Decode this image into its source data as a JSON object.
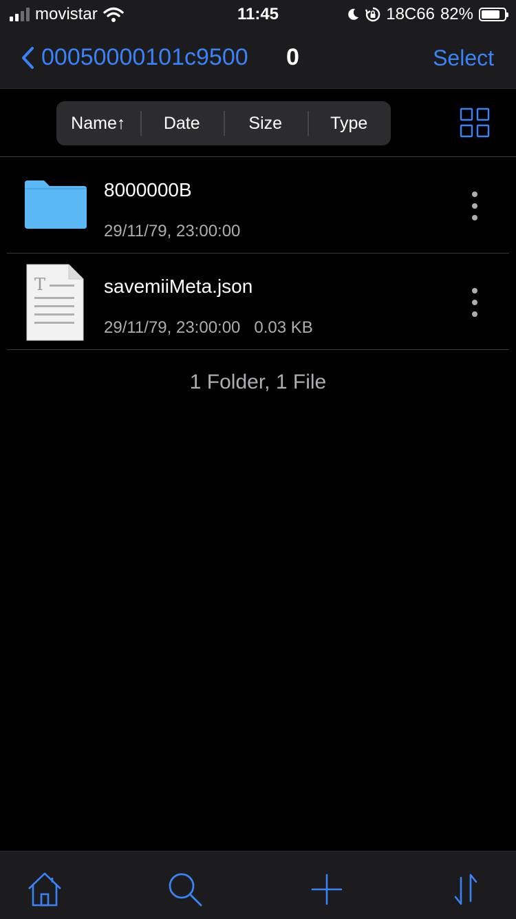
{
  "status_bar": {
    "carrier": "movistar",
    "time": "11:45",
    "network_label": "18C66",
    "battery_percent": "82%",
    "battery_level": 0.82
  },
  "nav": {
    "title": "00050000101c9500",
    "count": "0",
    "select_label": "Select"
  },
  "sort": {
    "name": "Name↑",
    "date": "Date",
    "size": "Size",
    "type": "Type"
  },
  "files": [
    {
      "name": "8000000B",
      "date": "29/11/79, 23:00:00",
      "size": "",
      "kind": "folder-icon"
    },
    {
      "name": "savemiiMeta.json",
      "date": "29/11/79, 23:00:00",
      "size": "0.03 KB",
      "kind": "text-file-icon"
    }
  ],
  "summary": "1 Folder, 1 File",
  "colors": {
    "accent": "#3a82f7",
    "folder": "#5ab8f5",
    "bar_bg": "#1c1c1e",
    "secondary_text": "#aeaeb2"
  }
}
